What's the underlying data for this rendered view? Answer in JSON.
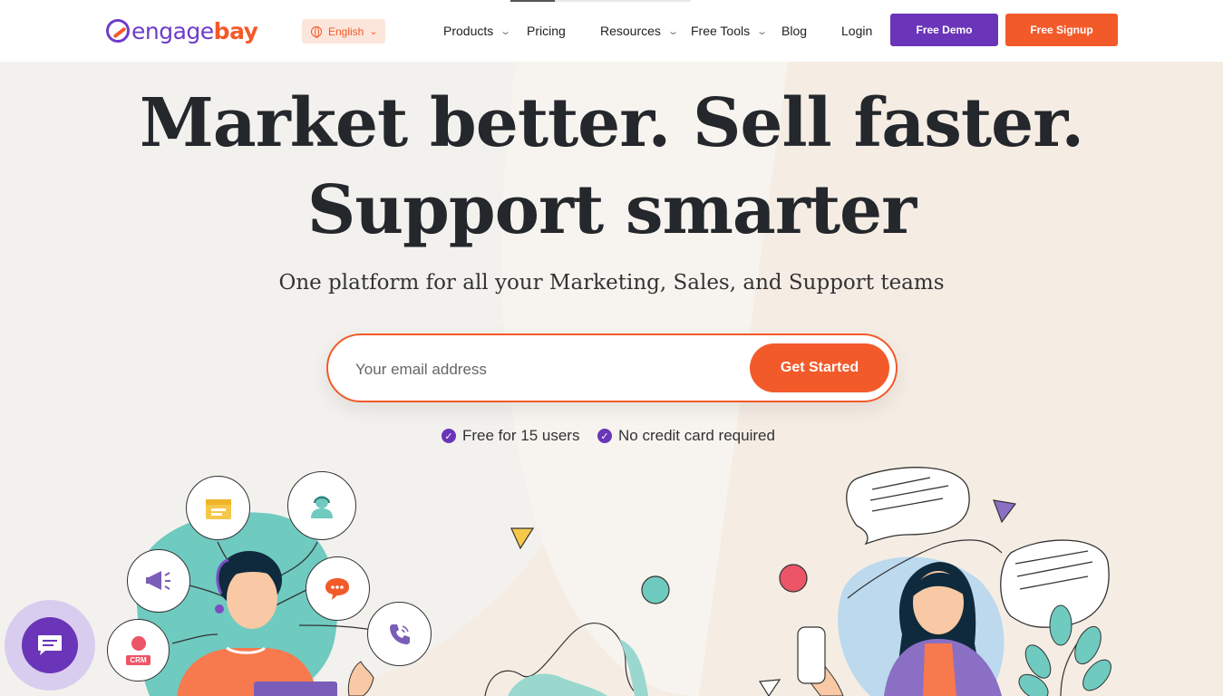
{
  "header": {
    "logo": {
      "part1": "engage",
      "part2": "bay"
    },
    "language": "English",
    "nav": [
      {
        "label": "Products",
        "dropdown": true
      },
      {
        "label": "Pricing",
        "dropdown": false
      },
      {
        "label": "Resources",
        "dropdown": true
      },
      {
        "label": "Free Tools",
        "dropdown": true
      },
      {
        "label": "Blog",
        "dropdown": false
      },
      {
        "label": "Login",
        "dropdown": false
      }
    ],
    "demo_label": "Free Demo",
    "signup_label": "Free Signup"
  },
  "hero": {
    "title_line1": "Market better. Sell faster.",
    "title_line2": "Support smarter",
    "subtitle": "One platform for all your Marketing, Sales, and Support teams",
    "email_placeholder": "Your email address",
    "cta_label": "Get Started",
    "perks": [
      "Free for 15 users",
      "No credit card required"
    ]
  },
  "illustration": {
    "crm_badge": "CRM"
  },
  "colors": {
    "brand_purple": "#6a35b8",
    "brand_orange": "#f35a2a",
    "teal": "#6fcac0",
    "hero_bg": "#f5ede4"
  }
}
